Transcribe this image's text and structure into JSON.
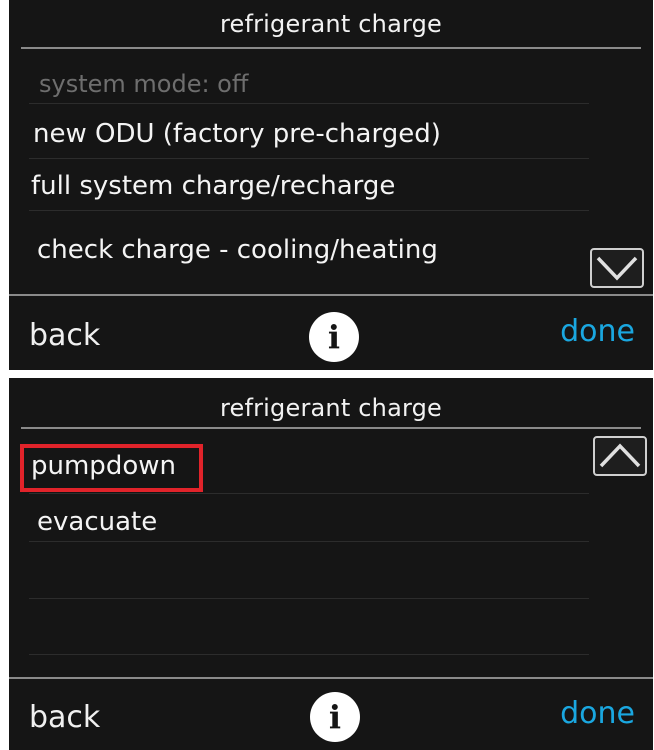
{
  "screens": [
    {
      "title": "refrigerant charge",
      "items": [
        {
          "label": "system mode: off",
          "enabled": false
        },
        {
          "label": "new ODU (factory pre-charged)",
          "enabled": true
        },
        {
          "label": "full system charge/recharge",
          "enabled": true
        },
        {
          "label": "check charge - cooling/heating",
          "enabled": true
        }
      ],
      "scroll_icon": "chevron-down-icon",
      "footer": {
        "back_label": "back",
        "info_label": "i",
        "done_label": "done"
      }
    },
    {
      "title": "refrigerant charge",
      "items": [
        {
          "label": "pumpdown",
          "enabled": true,
          "highlighted": true
        },
        {
          "label": "evacuate",
          "enabled": true
        }
      ],
      "scroll_icon": "chevron-up-icon",
      "footer": {
        "back_label": "back",
        "info_label": "i",
        "done_label": "done"
      }
    }
  ],
  "colors": {
    "background": "#151515",
    "text": "#f4f4f4",
    "disabled_text": "#6e6e6e",
    "accent_done": "#1aa7e0",
    "highlight": "#e1232a"
  }
}
